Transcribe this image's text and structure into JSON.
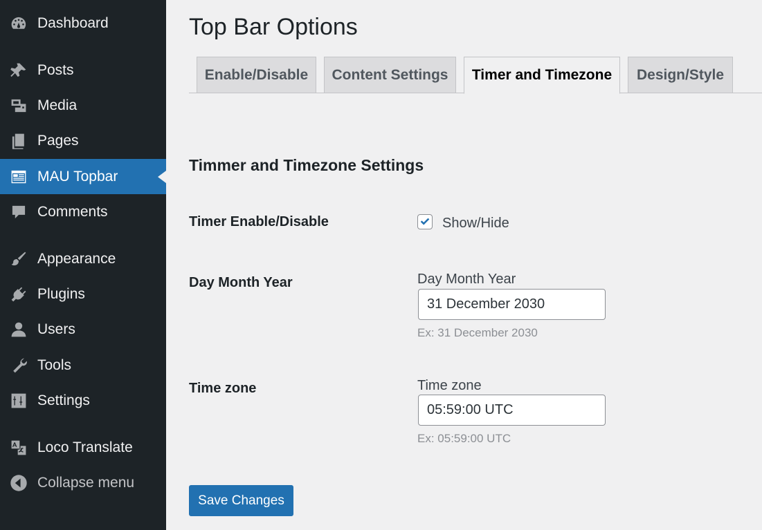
{
  "sidebar": {
    "items": [
      {
        "label": "Dashboard",
        "icon": "dashboard-icon"
      },
      {
        "label": "Posts",
        "icon": "pushpin-icon"
      },
      {
        "label": "Media",
        "icon": "media-icon"
      },
      {
        "label": "Pages",
        "icon": "pages-icon"
      },
      {
        "label": "MAU Topbar",
        "icon": "topbar-icon"
      },
      {
        "label": "Comments",
        "icon": "comment-icon"
      },
      {
        "label": "Appearance",
        "icon": "paintbrush-icon"
      },
      {
        "label": "Plugins",
        "icon": "plugin-icon"
      },
      {
        "label": "Users",
        "icon": "user-icon"
      },
      {
        "label": "Tools",
        "icon": "wrench-icon"
      },
      {
        "label": "Settings",
        "icon": "settings-icon"
      },
      {
        "label": "Loco Translate",
        "icon": "translate-icon"
      }
    ],
    "collapse_label": "Collapse menu"
  },
  "page": {
    "title": "Top Bar Options"
  },
  "tabs": [
    {
      "label": "Enable/Disable"
    },
    {
      "label": "Content Settings"
    },
    {
      "label": "Timer and Timezone"
    },
    {
      "label": "Design/Style"
    }
  ],
  "section": {
    "title": "Timmer and Timezone Settings"
  },
  "fields": {
    "timer": {
      "label": "Timer Enable/Disable",
      "checkbox_label": "Show/Hide",
      "checked": true
    },
    "date": {
      "label": "Day Month Year",
      "input_label": "Day Month Year",
      "value": "31 December 2030",
      "hint": "Ex: 31 December 2030"
    },
    "timezone": {
      "label": "Time zone",
      "input_label": "Time zone",
      "value": "05:59:00 UTC",
      "hint": "Ex: 05:59:00 UTC"
    }
  },
  "save_button": "Save Changes",
  "colors": {
    "sidebar_bg": "#1d2327",
    "accent": "#2271b1",
    "page_bg": "#f0f0f1"
  }
}
